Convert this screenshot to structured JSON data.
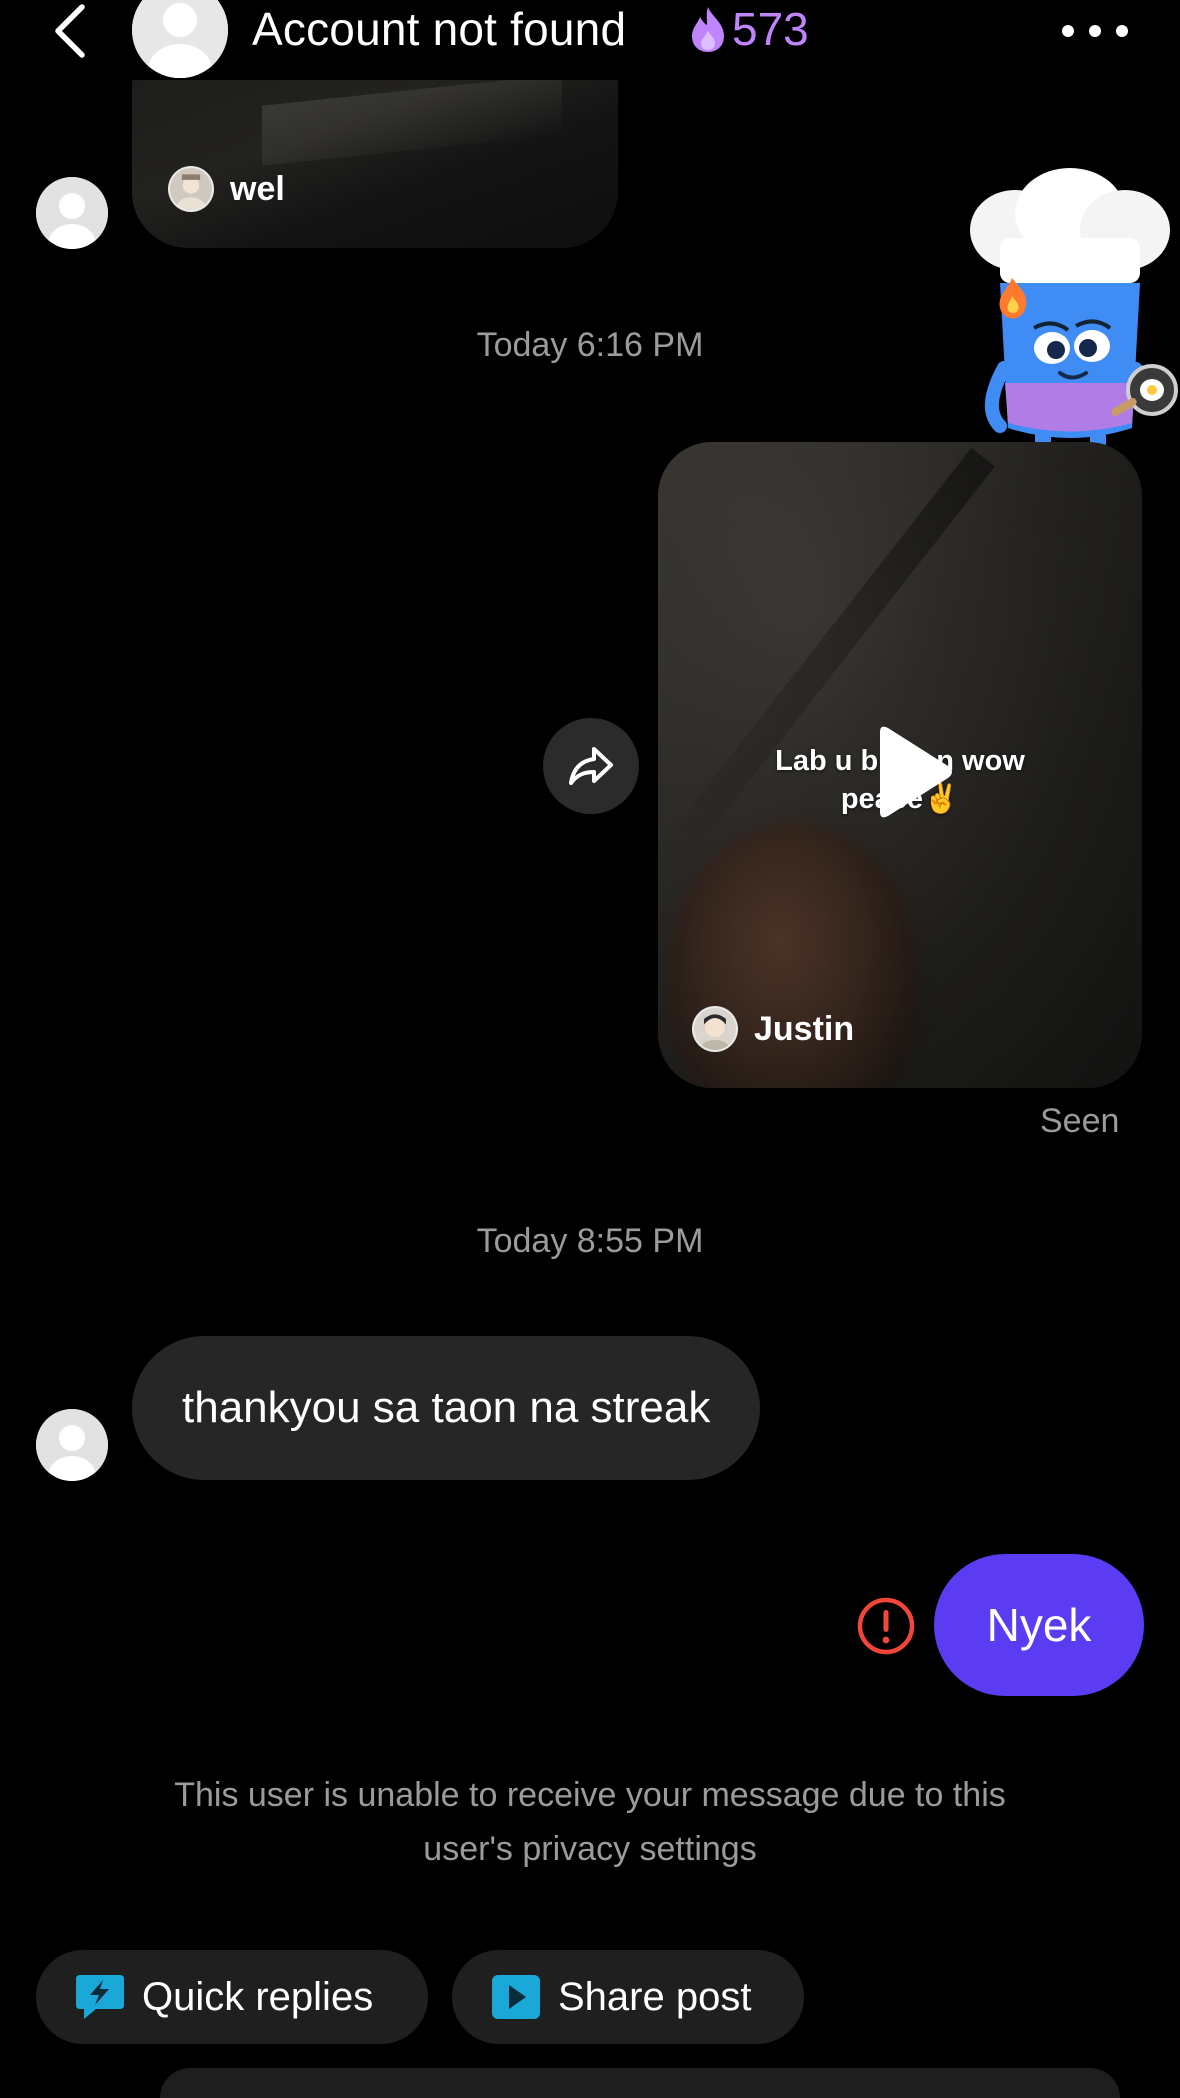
{
  "header": {
    "title": "Account not found",
    "streak_count": "573",
    "back_icon": "chevron-left-icon",
    "more_icon": "ellipsis-icon"
  },
  "messages": {
    "shared_video_top": {
      "creator": "wel"
    },
    "timestamp_1": "Today 6:16 PM",
    "shared_video_main": {
      "caption_line1": "Lab u b    n wow",
      "caption_line2": "peace✌️",
      "creator": "Justin"
    },
    "seen": "Seen",
    "timestamp_2": "Today 8:55 PM",
    "received_text": "thankyou sa taon na streak",
    "sent_text": "Nyek",
    "privacy_notice": "This user is unable to receive your message due to this user's privacy settings"
  },
  "actions": {
    "quick_replies": "Quick replies",
    "share_post": "Share post"
  },
  "colors": {
    "background": "#000000",
    "bubble_in": "#262626",
    "bubble_out": "#5b3cf2",
    "streak": "#c084fc",
    "error": "#f0473a",
    "muted_text": "#9b9b9b"
  }
}
